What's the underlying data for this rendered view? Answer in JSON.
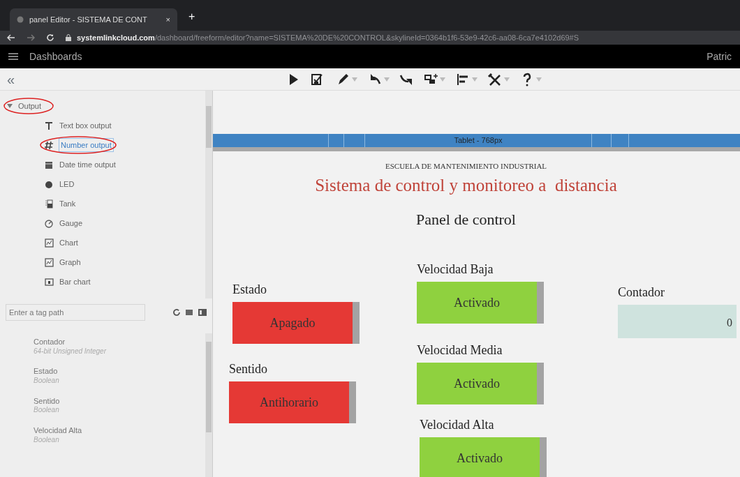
{
  "browser": {
    "tab_title": "panel Editor - SISTEMA DE CONT",
    "tab_close": "×",
    "new_tab": "+",
    "url_host": "systemlinkcloud.com",
    "url_path": "/dashboard/freeform/editor?name=SISTEMA%20DE%20CONTROL&skylineId=0364b1f6-53e9-42c6-aa08-6ca7e4102d69#S"
  },
  "app_bar": {
    "title": "Dashboards",
    "user": "Patric"
  },
  "toolbar": {
    "collapse": "«",
    "tools": [
      {
        "kind": "play",
        "dropdown": false
      },
      {
        "kind": "save",
        "dropdown": false
      },
      {
        "kind": "pencil",
        "dropdown": true
      },
      {
        "kind": "undo",
        "dropdown": true
      },
      {
        "kind": "redo",
        "dropdown": false
      },
      {
        "kind": "widget",
        "dropdown": true
      },
      {
        "kind": "align",
        "dropdown": true
      },
      {
        "kind": "tools",
        "dropdown": true
      },
      {
        "kind": "help",
        "dropdown": true
      }
    ]
  },
  "palette": {
    "group": {
      "label": "Output",
      "expanded": true,
      "circled": true
    },
    "items": [
      {
        "kind": "text",
        "label": "Text box output",
        "selected": false,
        "circled": false
      },
      {
        "kind": "number",
        "label": "Number output",
        "selected": true,
        "circled": true
      },
      {
        "kind": "date",
        "label": "Date time output",
        "selected": false,
        "circled": false
      },
      {
        "kind": "led",
        "label": "LED",
        "selected": false,
        "circled": false
      },
      {
        "kind": "tank",
        "label": "Tank",
        "selected": false,
        "circled": false
      },
      {
        "kind": "gauge",
        "label": "Gauge",
        "selected": false,
        "circled": false
      },
      {
        "kind": "chart",
        "label": "Chart",
        "selected": false,
        "circled": false
      },
      {
        "kind": "chart",
        "label": "Graph",
        "selected": false,
        "circled": false
      },
      {
        "kind": "bar",
        "label": "Bar chart",
        "selected": false,
        "circled": false
      }
    ]
  },
  "tag_search": {
    "placeholder": "Enter a tag path"
  },
  "tags": [
    {
      "name": "Contador",
      "type": "64-bit Unsigned Integer"
    },
    {
      "name": "Estado",
      "type": "Boolean"
    },
    {
      "name": "Sentido",
      "type": "Boolean"
    },
    {
      "name": "Velocidad Alta",
      "type": "Boolean"
    }
  ],
  "canvas": {
    "breakpoint": "Tablet - 768px",
    "school": "ESCUELA DE MANTENIMIENTO INDUSTRIAL",
    "title": "Sistema de control y monitoreo a  distancia",
    "subtitle": "Panel de control",
    "widgets": [
      {
        "kind": "boolean",
        "label": "Estado",
        "value": "Apagado",
        "on": false
      },
      {
        "kind": "boolean",
        "label": "Sentido",
        "value": "Antihorario",
        "on": false
      },
      {
        "kind": "boolean",
        "label": "Velocidad Baja",
        "value": "Activado",
        "on": true
      },
      {
        "kind": "boolean",
        "label": "Velocidad Media",
        "value": "Activado",
        "on": true
      },
      {
        "kind": "boolean",
        "label": "Velocidad Alta",
        "value": "Activado",
        "on": true
      },
      {
        "kind": "number",
        "label": "Contador",
        "value": "0"
      }
    ]
  }
}
